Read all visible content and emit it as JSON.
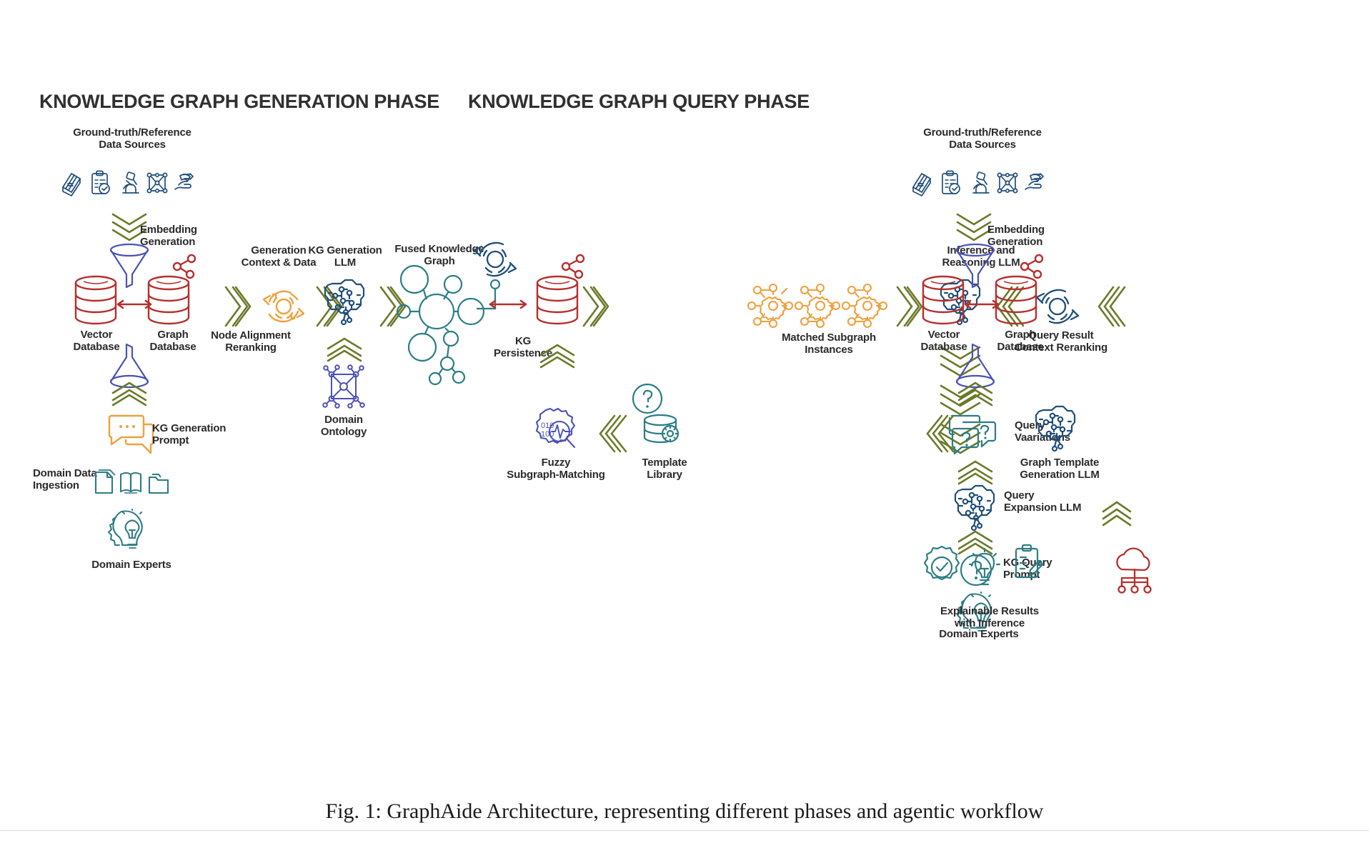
{
  "figure": {
    "caption": "Fig. 1: GraphAide Architecture, representing different phases and agentic workflow"
  },
  "colors": {
    "navy": "#1f4e79",
    "steel_blue": "#2b4a8b",
    "indigo": "#4b52b5",
    "red": "#b5302e",
    "orange": "#f0a03c",
    "olive": "#6b7a28",
    "teal": "#2b7d86",
    "dark_teal": "#2e6f78",
    "text": "#2b2b2b"
  },
  "phases": [
    {
      "id": "generation",
      "title": "KNOWLEDGE GRAPH GENERATION PHASE"
    },
    {
      "id": "query",
      "title": "KNOWLEDGE GRAPH QUERY PHASE"
    }
  ],
  "labels": {
    "ground_truth_left": "Ground-truth/Reference\nData Sources",
    "ground_truth_right": "Ground-truth/Reference\nData Sources",
    "embedding_generation_left": "Embedding\nGeneration",
    "embedding_generation_right": "Embedding\nGeneration",
    "vector_database_left": "Vector\nDatabase",
    "graph_database_left": "Graph\nDatabase",
    "vector_database_right": "Vector\nDatabase",
    "graph_database_right": "Graph\nDatabase",
    "node_alignment_reranking": "Node Alignment\nReranking",
    "generation_context_data": "Generation\nContext & Data",
    "kg_generation_llm": "KG Generation\nLLM",
    "domain_ontology": "Domain\nOntology",
    "kg_generation_prompt": "KG Generation\nPrompt",
    "domain_data_ingestion": "Domain Data\nIngestion",
    "domain_experts_left": "Domain Experts",
    "fused_knowledge_graph": "Fused Knowledge Graph",
    "kg_persistence": "KG\nPersistence",
    "fuzzy_subgraph_matching": "Fuzzy\nSubgraph-Matching",
    "template_library": "Template\nLibrary",
    "matched_subgraph_instances": "Matched Subgraph\nInstances",
    "inference_and_reasoning_llm": "Inference and\nReasoning LLM",
    "query_result_context_reranking": "Query Result\nContext Reranking",
    "graph_template_generation_llm": "Graph Template\nGeneration LLM",
    "explainable_results": "Explainable Results\nwith Inference",
    "query_variations": "Query\nVaariations",
    "query_expansion_llm": "Query\nExpansion LLM",
    "kg_query_prompt": "KG Query\nPrompt",
    "domain_experts_right": "Domain Experts"
  },
  "icons": {
    "source_icons_left": [
      "book-icon",
      "clipboard-check-icon",
      "microscope-icon",
      "network-mesh-icon",
      "hand-data-icon"
    ],
    "source_icons_right": [
      "book-icon",
      "clipboard-check-icon",
      "microscope-icon",
      "network-mesh-icon",
      "hand-data-icon"
    ],
    "ingestion_icons": [
      "document-icon",
      "open-book-icon",
      "folder-icon"
    ],
    "explainable_icons": [
      "gear-check-icon",
      "lightbulb-icon",
      "clipboard-pencil-icon"
    ]
  }
}
